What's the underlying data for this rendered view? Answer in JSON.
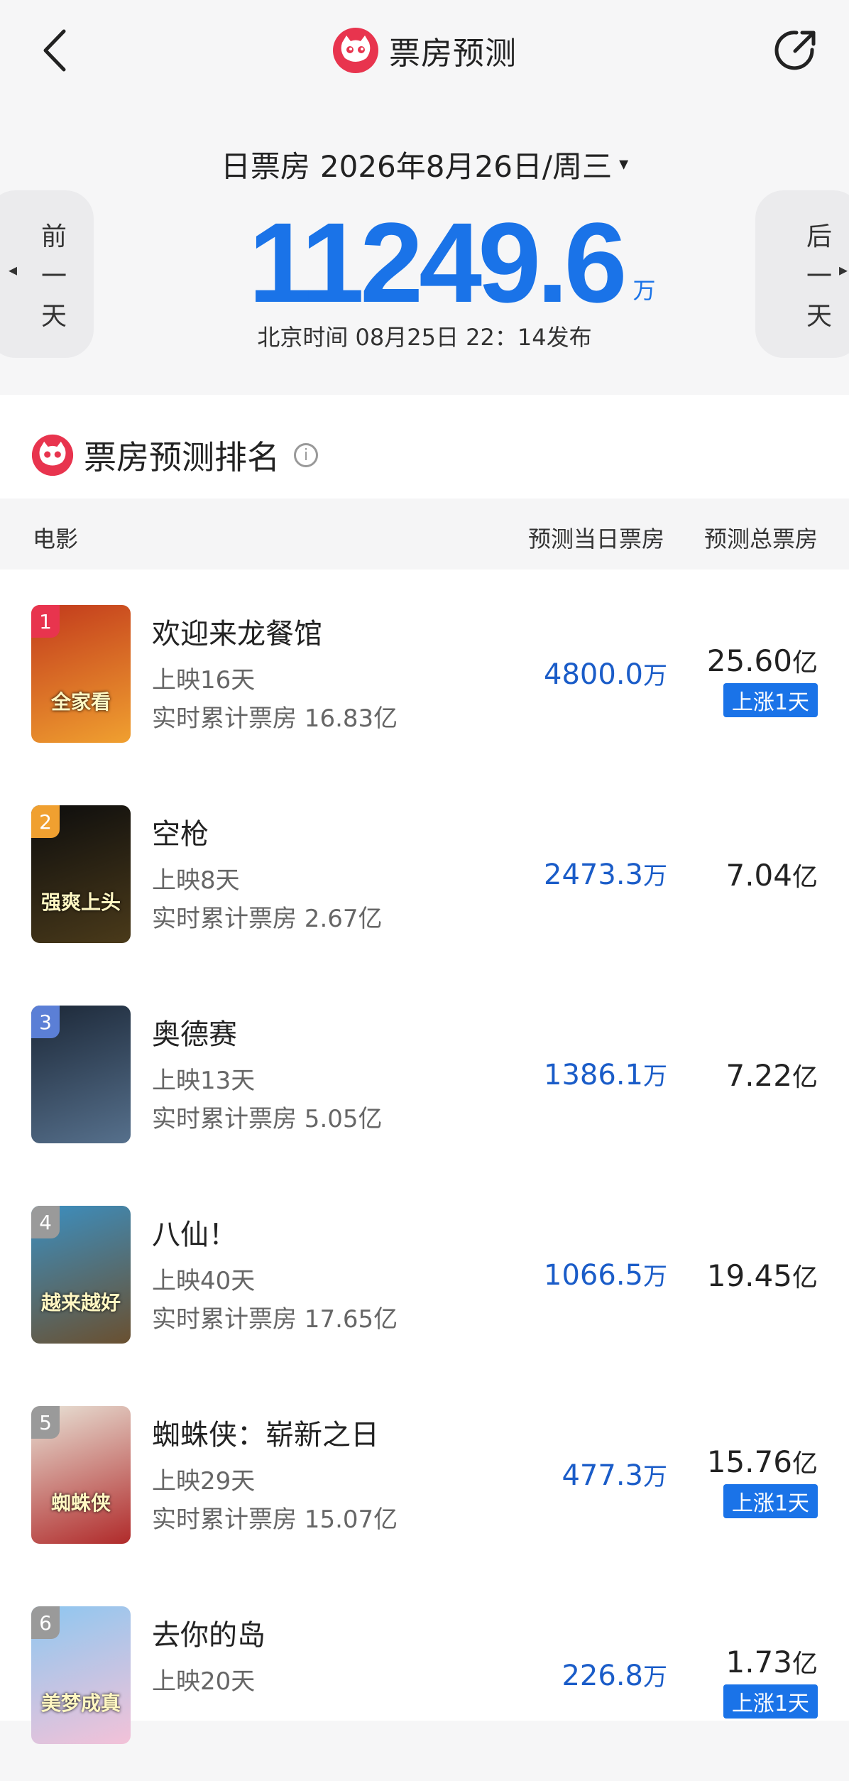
{
  "header": {
    "title": "票房预测",
    "back_icon": "chevron-left-icon",
    "share_icon": "share-icon",
    "logo_icon": "maoyan-cat-logo"
  },
  "date_selector": {
    "label": "日票房",
    "date": "2026年8月26日/周三",
    "caret": "▾"
  },
  "prev_day": {
    "label": "前一天",
    "chars": [
      "前",
      "一",
      "天"
    ],
    "arrow": "◂"
  },
  "next_day": {
    "label": "后一天",
    "chars": [
      "后",
      "一",
      "天"
    ],
    "arrow": "▸"
  },
  "summary": {
    "value": "11249.6",
    "unit": "万",
    "published": "北京时间 08月25日 22：14发布"
  },
  "ranking": {
    "title": "票房预测排名",
    "info_icon": "ⓘ",
    "columns": {
      "movie": "电影",
      "day_forecast": "预测当日票房",
      "total_forecast": "预测总票房"
    },
    "movies": [
      {
        "rank": "1",
        "rank_color": "#e8344e",
        "title": "欢迎来龙餐馆",
        "days": "上映16天",
        "cumulative": "实时累计票房 16.83亿",
        "day_value": "4800.0",
        "day_unit": "万",
        "total_value": "25.60",
        "total_unit": "亿",
        "badge": "上涨1天",
        "poster_text": "全家看",
        "poster_colors": [
          "#c23a1c",
          "#f0a030"
        ]
      },
      {
        "rank": "2",
        "rank_color": "#f0a030",
        "title": "空枪",
        "days": "上映8天",
        "cumulative": "实时累计票房 2.67亿",
        "day_value": "2473.3",
        "day_unit": "万",
        "total_value": "7.04",
        "total_unit": "亿",
        "badge": "",
        "poster_text": "强爽上头",
        "poster_colors": [
          "#0d0d0d",
          "#4a3a1a"
        ]
      },
      {
        "rank": "3",
        "rank_color": "#5b7fd6",
        "title": "奥德赛",
        "days": "上映13天",
        "cumulative": "实时累计票房 5.05亿",
        "day_value": "1386.1",
        "day_unit": "万",
        "total_value": "7.22",
        "total_unit": "亿",
        "badge": "",
        "poster_text": "",
        "poster_colors": [
          "#1c2838",
          "#56708c"
        ]
      },
      {
        "rank": "4",
        "rank_color": "#9a9a9a",
        "title": "八仙！",
        "days": "上映40天",
        "cumulative": "实时累计票房 17.65亿",
        "day_value": "1066.5",
        "day_unit": "万",
        "total_value": "19.45",
        "total_unit": "亿",
        "badge": "",
        "poster_text": "越来越好",
        "poster_colors": [
          "#3c8fc0",
          "#6a5030"
        ]
      },
      {
        "rank": "5",
        "rank_color": "#9a9a9a",
        "title": "蜘蛛侠：崭新之日",
        "days": "上映29天",
        "cumulative": "实时累计票房 15.07亿",
        "day_value": "477.3",
        "day_unit": "万",
        "total_value": "15.76",
        "total_unit": "亿",
        "badge": "上涨1天",
        "poster_text": "蜘蛛侠",
        "poster_colors": [
          "#e8e2d6",
          "#b02a2a"
        ]
      },
      {
        "rank": "6",
        "rank_color": "#9a9a9a",
        "title": "去你的岛",
        "days": "上映20天",
        "cumulative": "",
        "day_value": "226.8",
        "day_unit": "万",
        "total_value": "1.73",
        "total_unit": "亿",
        "badge": "上涨1天",
        "poster_text": "美梦成真",
        "poster_colors": [
          "#8ec7f0",
          "#f3c2d8"
        ]
      }
    ]
  }
}
